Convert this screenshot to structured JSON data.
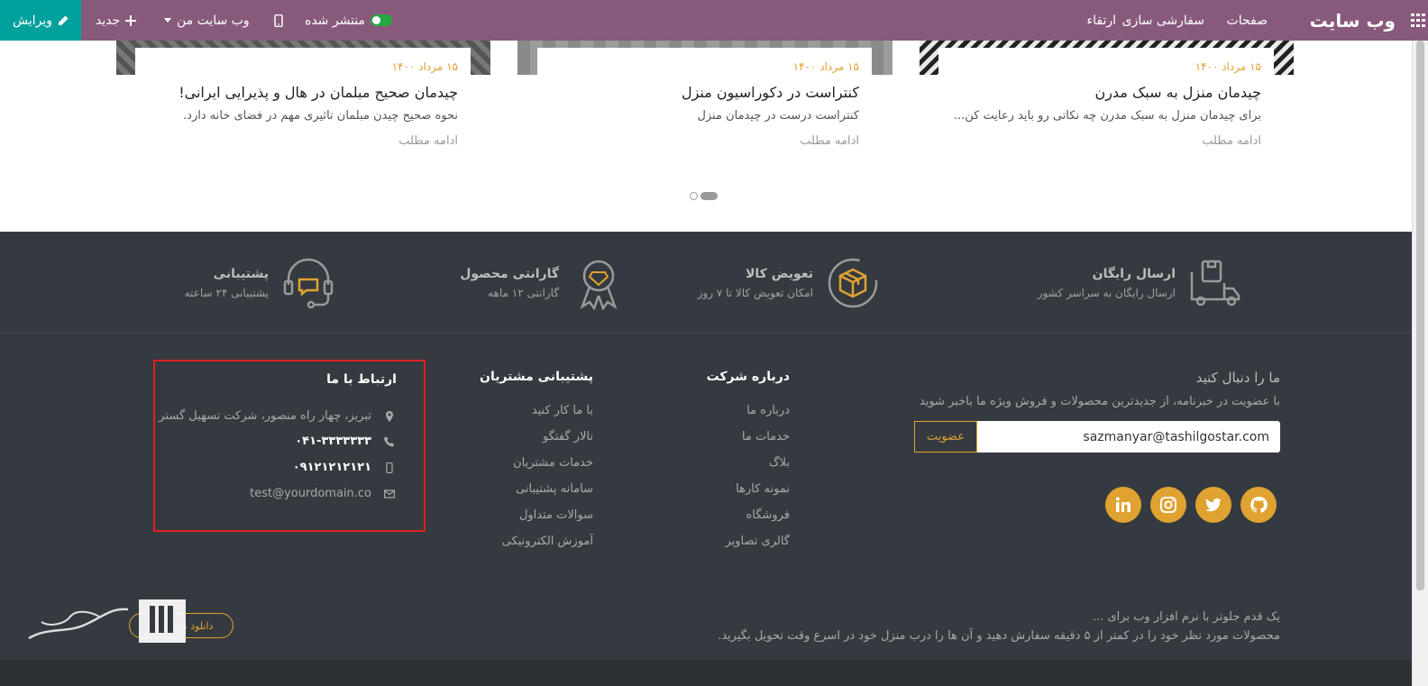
{
  "topbar": {
    "brand": "وب سایت",
    "menu": [
      "صفحات",
      "سفارشی سازی",
      "ارتقاء"
    ],
    "published": "منتشر شده",
    "my_site": "وب سایت من",
    "new": "جدید",
    "edit": "ویرایش"
  },
  "blog": {
    "cards": [
      {
        "date": "۱۵ مرداد ۱۴۰۰",
        "title": "چیدمان منزل به سبک مدرن",
        "desc": "برای چیدمان منزل به سبک مدرن چه نکاتی رو باید رعایت کن...",
        "more": "ادامه مطلب"
      },
      {
        "date": "۱۵ مرداد ۱۴۰۰",
        "title": "کنتراست در دکوراسیون منزل",
        "desc": "کنتراست درست در چیدمان منزل",
        "more": "ادامه مطلب"
      },
      {
        "date": "۱۵ مرداد ۱۴۰۰",
        "title": "چیدمان صحیح مبلمان در هال و پذیرایی ایرانی!",
        "desc": "نحوه صحیح چیدن مبلمان تاثیری مهم در فضای خانه دارد.",
        "more": "ادامه مطلب"
      }
    ]
  },
  "features": [
    {
      "title": "ارسال رایگان",
      "sub": "ارسال رایگان به سراسر کشور",
      "icon": "delivery-truck-icon"
    },
    {
      "title": "تعویض کالا",
      "sub": "امکان تعویض کالا تا ۷ روز",
      "icon": "exchange-box-icon"
    },
    {
      "title": "گارانتی محصول",
      "sub": "گارانتی ۱۲ ماهه",
      "icon": "warranty-badge-icon"
    },
    {
      "title": "پشتیبانی",
      "sub": "پشتیبانی ۲۴ ساعته",
      "icon": "headset-icon"
    }
  ],
  "footer": {
    "follow": {
      "title": "ما را دنبال کنید",
      "sub": "با عضویت در خبرنامه، از جدیدترین محصولات و فروش ویژه ما باخبر شوید",
      "email_value": "sazmanyar@tashilgostar.com",
      "subscribe": "عضویت"
    },
    "about": {
      "title": "درباره شرکت",
      "links": [
        "درباره ما",
        "خدمات ما",
        "بلاگ",
        "نمونه کارها",
        "فروشگاه",
        "گالری تصاویر"
      ]
    },
    "support": {
      "title": "پشتیبانی مشتریان",
      "links": [
        "با ما کار کنید",
        "تالار گفتگو",
        "خدمات مشتریان",
        "سامانه پشتیبانی",
        "سوالات متداول",
        "آموزش الکترونیکی"
      ]
    },
    "contact": {
      "title": "ارتباط با ما",
      "address": "تبریز، چهار راه منصور، شرکت تسهیل گستر",
      "phone": "۰۴۱-۳۳۳۳۳۳۳",
      "mobile": "۰۹۱۲۱۲۱۲۱۲۱",
      "email": "test@yourdomain.co"
    },
    "bottom_line1": "یک قدم جلوتر با نرم افزار وب برای ...",
    "bottom_line2": "محصولات مورد نظر خود را در کمتر از ۵ دقیقه سفارش دهید و آن ها را درب منزل خود در اسرع وقت تحویل بگیرید.",
    "download": "دانلود نرم افزار"
  },
  "colors": {
    "topbar": "#875A7B",
    "edit": "#00A09D",
    "accent": "#E0A230",
    "footer": "#343a40",
    "highlight": "#e02020"
  }
}
